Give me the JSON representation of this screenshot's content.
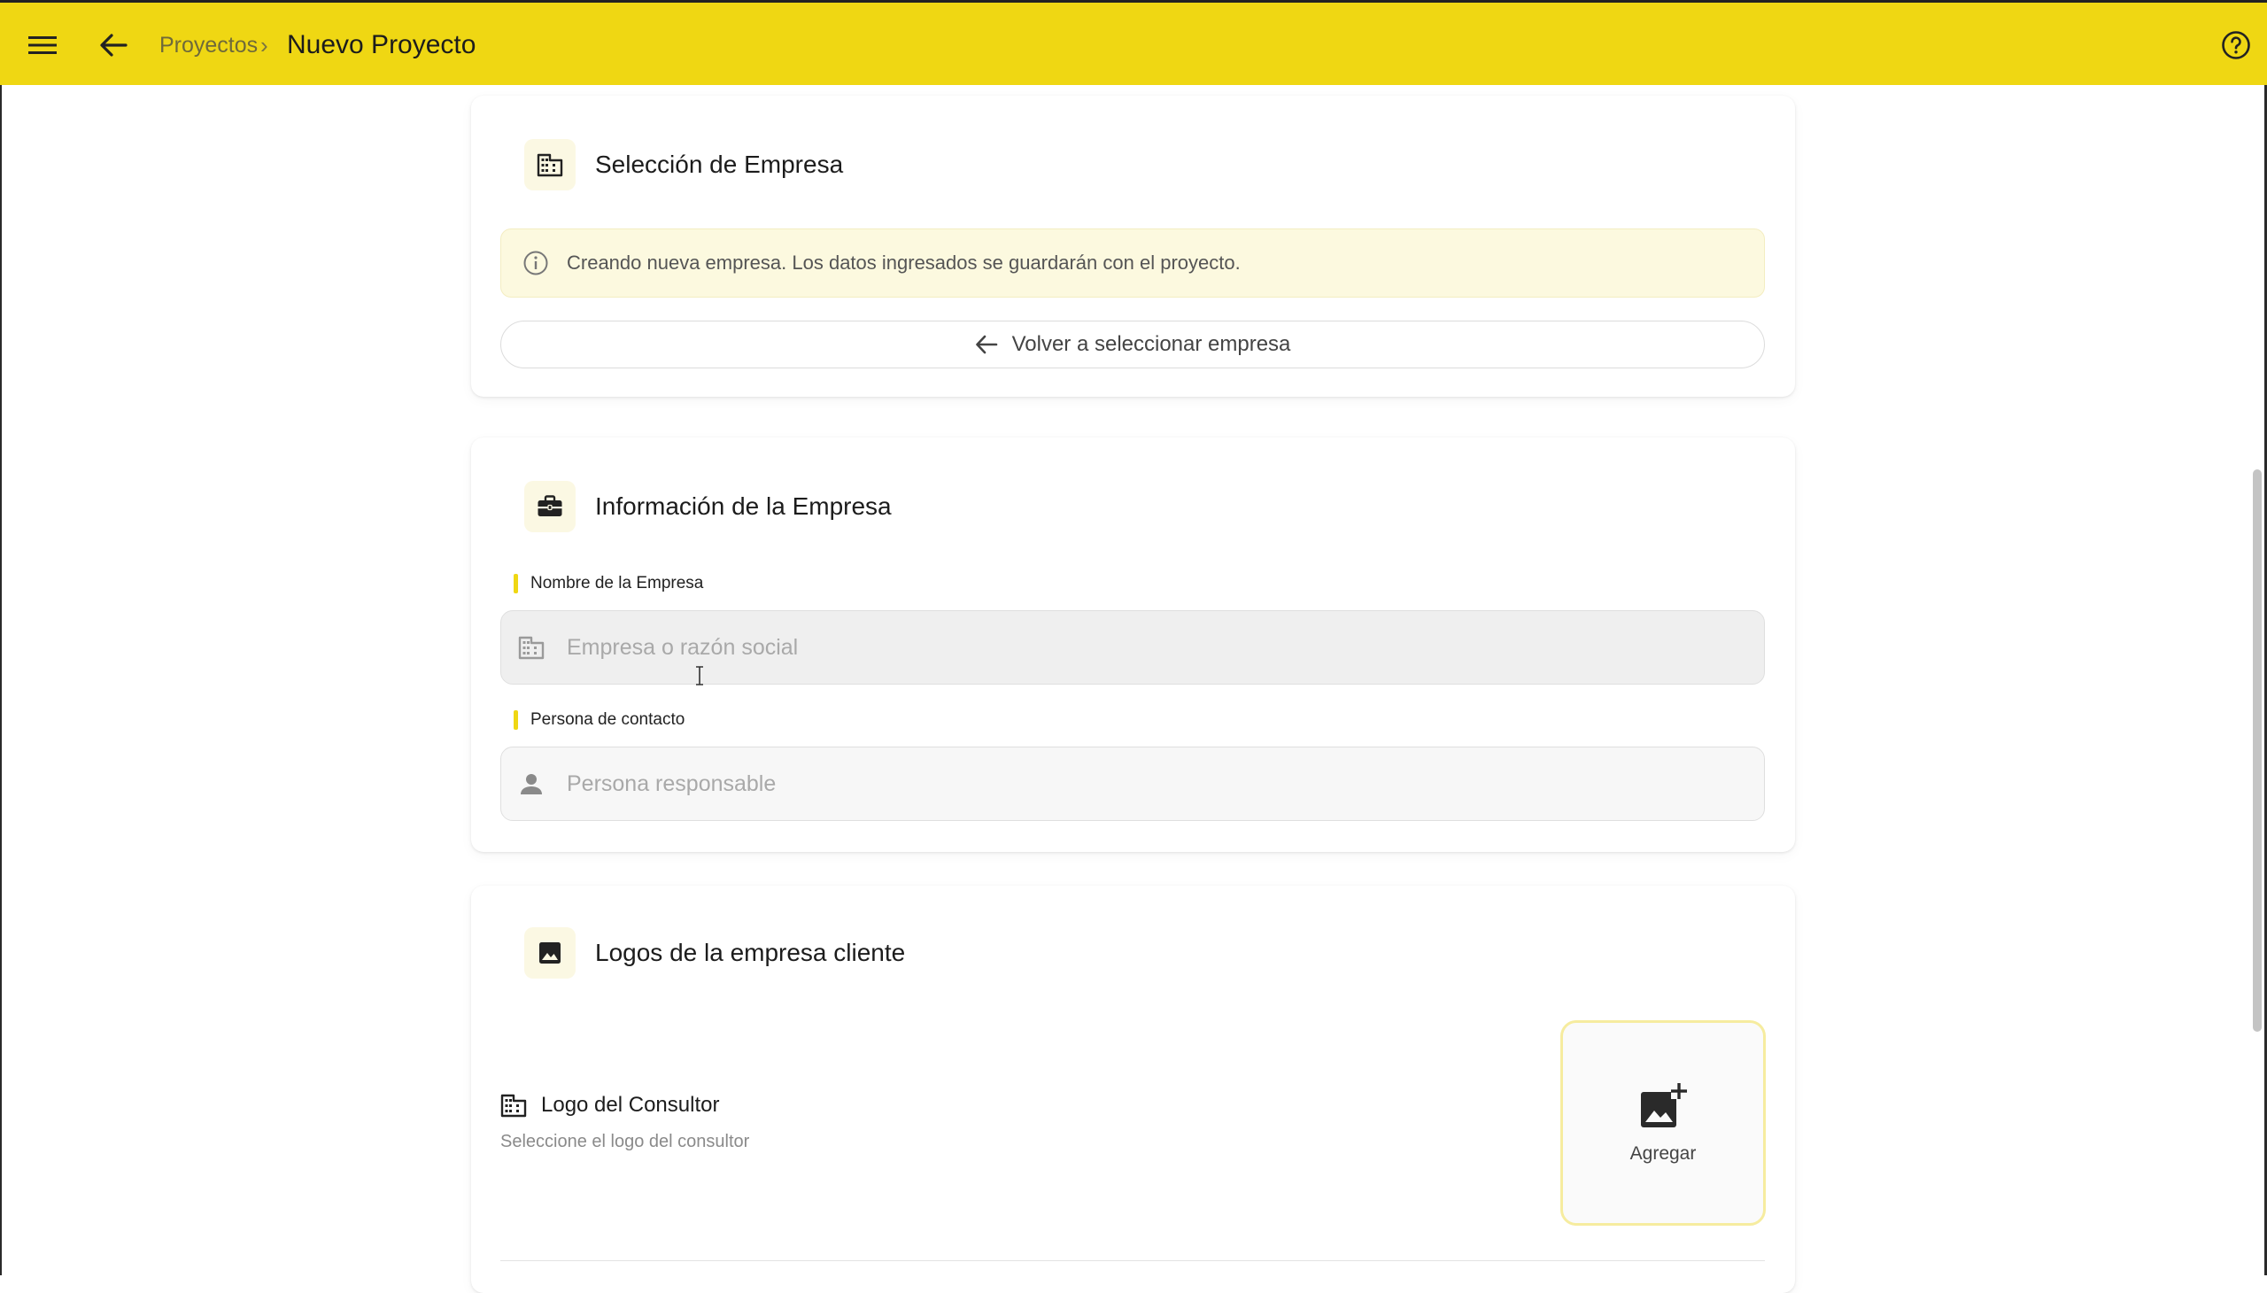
{
  "header": {
    "menu_icon": "hamburger-menu-icon",
    "back_icon": "arrow-left-icon",
    "breadcrumb_parent": "Proyectos",
    "breadcrumb_separator": "›",
    "title": "Nuevo Proyecto",
    "help_icon": "help-circle-icon",
    "accent_color": "#efd713"
  },
  "company_selection": {
    "icon": "building-icon",
    "title": "Selección de Empresa",
    "info_icon": "info-icon",
    "info_text": "Creando nueva empresa. Los datos ingresados se guardarán con el proyecto.",
    "back_button_label": "Volver a seleccionar empresa"
  },
  "company_info": {
    "icon": "briefcase-icon",
    "title": "Información de la Empresa",
    "company_name_label": "Nombre de la Empresa",
    "company_name_placeholder": "Empresa o razón social",
    "company_name_value": "",
    "contact_label": "Persona de contacto",
    "contact_placeholder": "Persona responsable",
    "contact_value": ""
  },
  "client_logos": {
    "icon": "image-icon",
    "title": "Logos de la empresa cliente",
    "consultant_logo_title": "Logo del Consultor",
    "consultant_logo_subtitle": "Seleccione el logo del consultor",
    "add_label": "Agregar"
  }
}
